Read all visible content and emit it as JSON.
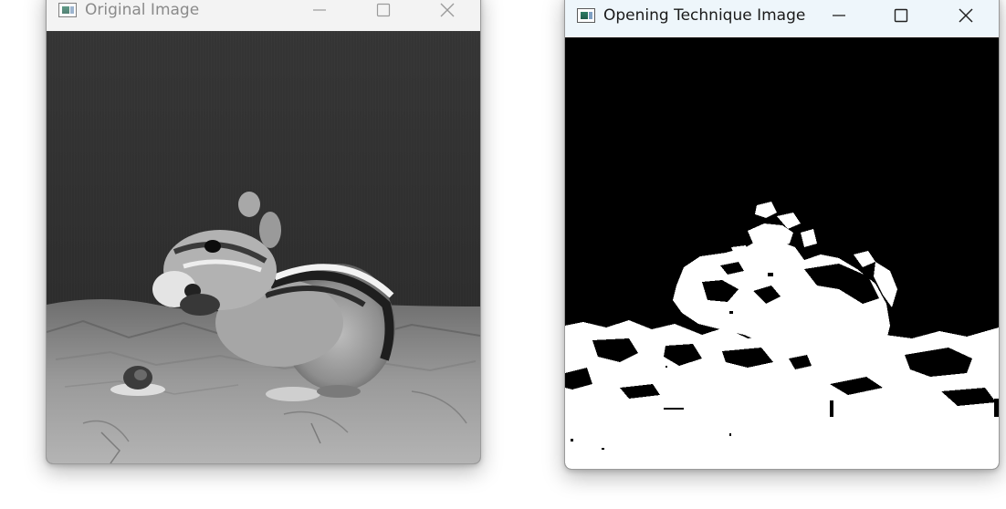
{
  "windows": [
    {
      "title": "Original Image",
      "state": "inactive",
      "icon": "app-window-icon",
      "controls": [
        "minimize-icon",
        "maximize-icon",
        "close-icon"
      ],
      "image": "grayscale photo of a chipmunk eating beside a small snail shell"
    },
    {
      "title": "Opening Technique Image",
      "state": "active",
      "icon": "app-window-icon",
      "controls": [
        "minimize-icon",
        "maximize-icon",
        "close-icon"
      ],
      "image": "black and white binary mask result of morphological opening"
    }
  ],
  "colors": {
    "titlebar_inactive_text": "#8a8a8a",
    "titlebar_active_text": "#1a1a1a",
    "mask_background": "#000000",
    "mask_foreground": "#ffffff"
  }
}
